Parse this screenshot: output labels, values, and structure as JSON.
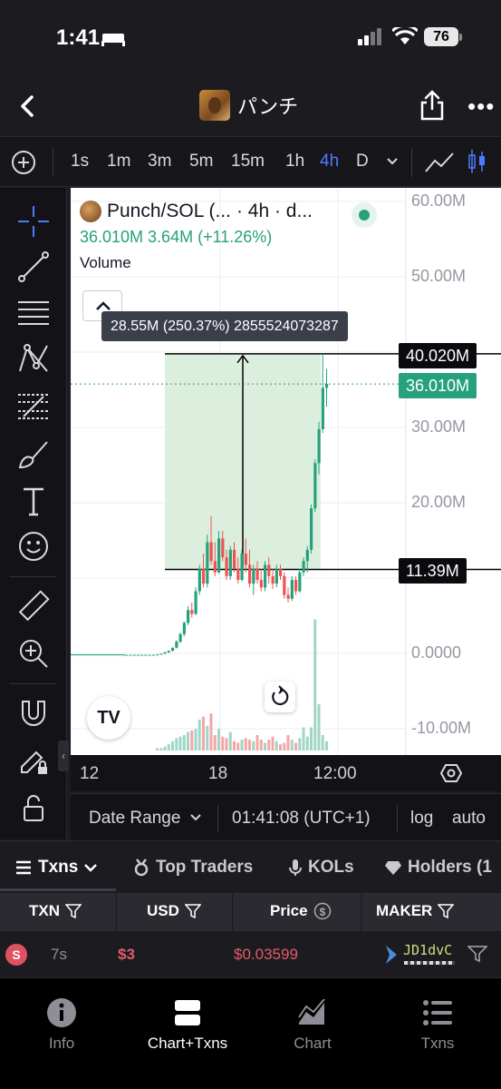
{
  "status": {
    "time": "1:41",
    "battery": "76"
  },
  "nav": {
    "title": "パンチ"
  },
  "timeframes": [
    "1s",
    "1m",
    "3m",
    "5m",
    "15m",
    "1h",
    "4h",
    "D"
  ],
  "active_timeframe": "4h",
  "legend": {
    "symbol": "Punch/SOL (...",
    "interval": "· 4h · d...",
    "stats": "36.010M  3.64M (+11.26%)",
    "volume_label": "Volume"
  },
  "measure_label": "28.55M (250.37%) 2855524073287",
  "price_tags": {
    "high": "40.020M",
    "last": "36.010M",
    "low": "11.39M"
  },
  "colors": {
    "up": "#26a17b",
    "down": "#ef5350",
    "accent": "#4d7cff",
    "measure_fill": "#dcefdf"
  },
  "chart_data": {
    "type": "candlestick",
    "y_axis_labels": [
      "60.00M",
      "50.00M",
      "40.00M",
      "30.00M",
      "20.00M",
      "10.00M",
      "0.0000",
      "-10.00M"
    ],
    "x_axis_labels": [
      "12",
      "18",
      "12:00"
    ],
    "ylim": [
      -12000000,
      62000000
    ],
    "measure": {
      "from": 11.39,
      "to": 40.02,
      "unit": "M",
      "change": "28.55M",
      "percent": "250.37%"
    },
    "candles": [
      [
        0.05,
        0.05,
        0.05,
        0.05
      ],
      [
        0.05,
        0.05,
        0.05,
        0.05
      ],
      [
        0.05,
        0.05,
        0.05,
        0.05
      ],
      [
        0.05,
        0.05,
        0.05,
        0.05
      ],
      [
        0.05,
        0.05,
        0.05,
        0.05
      ],
      [
        0.05,
        0.05,
        0.05,
        0.05
      ],
      [
        0.05,
        0.05,
        0.05,
        0.05
      ],
      [
        0.05,
        0.05,
        0.05,
        0.05
      ],
      [
        0.05,
        0.1,
        0.05,
        0.1
      ],
      [
        0.1,
        0.2,
        0.1,
        0.2
      ],
      [
        0.2,
        0.4,
        0.2,
        0.4
      ],
      [
        0.4,
        0.6,
        0.3,
        0.6
      ],
      [
        0.6,
        1.0,
        0.5,
        1.0
      ],
      [
        1.0,
        2.0,
        0.9,
        1.8
      ],
      [
        1.8,
        3.0,
        1.6,
        2.8
      ],
      [
        2.8,
        4.5,
        2.5,
        4.3
      ],
      [
        4.3,
        6.5,
        4.0,
        6.0
      ],
      [
        6.0,
        7.0,
        5.0,
        5.5
      ],
      [
        5.5,
        9.0,
        5.3,
        8.5
      ],
      [
        8.5,
        12.0,
        8.0,
        11.5
      ],
      [
        11.5,
        13.5,
        9.0,
        9.5
      ],
      [
        9.5,
        16.0,
        9.0,
        15.0
      ],
      [
        15.0,
        18.5,
        12.0,
        12.5
      ],
      [
        12.5,
        15.0,
        10.5,
        11.0
      ],
      [
        11.0,
        16.5,
        10.8,
        15.5
      ],
      [
        15.5,
        16.5,
        12.5,
        13.0
      ],
      [
        13.0,
        14.0,
        10.0,
        10.5
      ],
      [
        10.5,
        14.5,
        10.0,
        14.0
      ],
      [
        14.0,
        15.0,
        11.0,
        11.5
      ],
      [
        11.5,
        13.0,
        9.5,
        10.0
      ],
      [
        10.0,
        14.0,
        9.8,
        13.5
      ],
      [
        13.5,
        15.5,
        11.0,
        12.0
      ],
      [
        12.0,
        14.0,
        9.0,
        9.5
      ],
      [
        9.5,
        12.0,
        8.0,
        11.5
      ],
      [
        11.5,
        12.5,
        9.5,
        10.0
      ],
      [
        10.0,
        11.5,
        8.5,
        9.0
      ],
      [
        9.0,
        12.5,
        8.5,
        12.0
      ],
      [
        12.0,
        13.0,
        9.5,
        10.5
      ],
      [
        10.5,
        11.5,
        8.8,
        9.5
      ],
      [
        9.5,
        12.0,
        9.0,
        11.5
      ],
      [
        11.5,
        12.0,
        10.0,
        10.5
      ],
      [
        10.5,
        11.0,
        7.5,
        8.0
      ],
      [
        8.0,
        9.0,
        7.0,
        7.5
      ],
      [
        7.5,
        10.5,
        7.2,
        10.0
      ],
      [
        10.0,
        10.5,
        8.0,
        8.5
      ],
      [
        8.5,
        11.5,
        8.3,
        11.0
      ],
      [
        11.0,
        13.0,
        10.5,
        12.5
      ],
      [
        12.5,
        14.5,
        11.0,
        14.0
      ],
      [
        14.0,
        20.0,
        13.5,
        19.5
      ],
      [
        19.5,
        26.0,
        19.0,
        25.5
      ],
      [
        25.5,
        31.0,
        24.0,
        30.0
      ],
      [
        30.0,
        40.02,
        29.5,
        35.5
      ],
      [
        35.5,
        38.0,
        33.0,
        36.01
      ]
    ],
    "volumes": [
      0,
      0,
      0,
      0,
      0,
      0,
      0,
      0,
      0.3,
      0.3,
      0.5,
      0.8,
      1.2,
      1.6,
      1.8,
      2.0,
      2.4,
      2.6,
      2.8,
      4.0,
      4.4,
      3.2,
      4.8,
      2.0,
      2.8,
      1.8,
      1.6,
      2.4,
      1.2,
      1.0,
      1.4,
      1.6,
      1.4,
      1.2,
      2.0,
      1.4,
      1.0,
      1.4,
      1.8,
      1.2,
      0.8,
      1.0,
      2.0,
      1.4,
      1.0,
      1.6,
      3.0,
      1.8,
      3.0,
      17.0,
      6.0,
      2.0,
      1.2
    ]
  },
  "chart_bottom": {
    "date_range": "Date Range",
    "clock": "01:41:08 (UTC+1)",
    "log": "log",
    "auto": "auto"
  },
  "tabs": [
    {
      "label": "Txns"
    },
    {
      "label": "Top Traders"
    },
    {
      "label": "KOLs"
    },
    {
      "label": "Holders (1"
    }
  ],
  "table": {
    "headers": [
      "TXN",
      "USD",
      "Price",
      "MAKER"
    ],
    "rows": [
      {
        "type": "S",
        "age": "7s",
        "usd": "$3",
        "price": "$0.03599",
        "maker": "JD1dvC"
      }
    ]
  },
  "bottom_nav": [
    "Info",
    "Chart+Txns",
    "Chart",
    "Txns"
  ],
  "bottom_nav_active": "Chart+Txns"
}
